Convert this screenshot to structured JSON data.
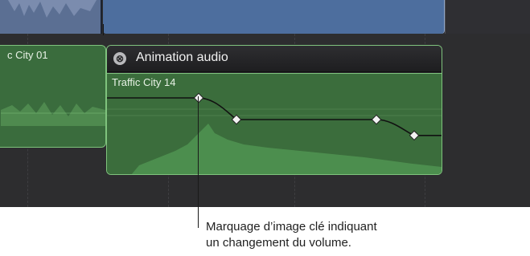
{
  "clips": {
    "left_clip_name": "c City 01",
    "group_title": "Animation audio",
    "inner_clip_name": "Traffic City 14",
    "close_icon": "⊗"
  },
  "keyframes": {
    "volume_levels": [
      1.0,
      0.55,
      0.55,
      0.22
    ]
  },
  "annotation": {
    "line1": "Marquage d’image clé indiquant",
    "line2": "un changement du volume."
  },
  "colors": {
    "timeline_bg": "#2d2d2f",
    "audio_clip": "#3b6d3c",
    "clip_border": "#7fc37d",
    "video_clip": "#4d6e9e"
  }
}
